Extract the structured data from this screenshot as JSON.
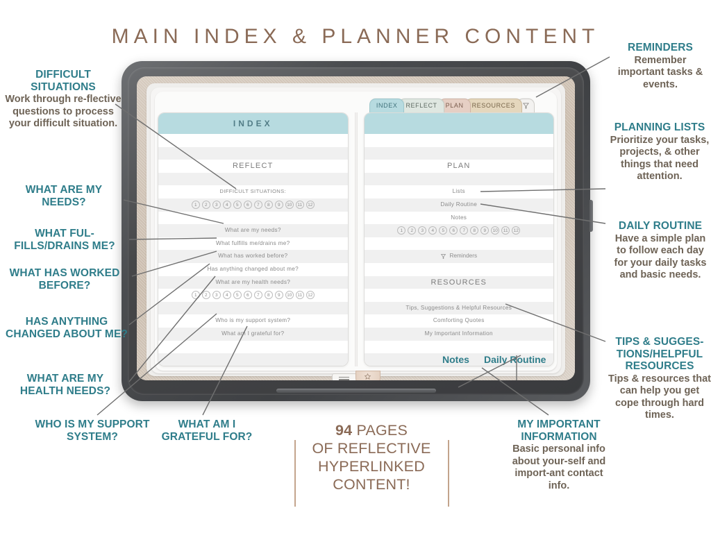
{
  "header": {
    "title": "MAIN INDEX & PLANNER CONTENT"
  },
  "colors": {
    "teal_heading": "#2f7d8a",
    "body_brown": "#6e6356",
    "title_brown": "#8a6a56",
    "page_header_teal": "#b7dbe0",
    "row_alt": "#f0f0f0"
  },
  "tablet": {
    "tabs": [
      {
        "label": "INDEX",
        "name": "tab-index"
      },
      {
        "label": "REFLECT",
        "name": "tab-reflect"
      },
      {
        "label": "PLAN",
        "name": "tab-plan"
      },
      {
        "label": "RESOURCES",
        "name": "tab-resources"
      },
      {
        "label": "",
        "name": "tab-reminders-bell-icon"
      }
    ],
    "left_page": {
      "header": "INDEX",
      "rows": [
        {
          "text": "",
          "type": "blank"
        },
        {
          "text": "",
          "type": "blank"
        },
        {
          "text": "REFLECT",
          "type": "section"
        },
        {
          "text": "",
          "type": "blank"
        },
        {
          "text": "DIFFICULT SITUATIONS:",
          "type": "caption"
        },
        {
          "text": "",
          "type": "numbers"
        },
        {
          "text": "",
          "type": "blank"
        },
        {
          "text": "What are my needs?",
          "type": "link"
        },
        {
          "text": "What fulfills me/drains me?",
          "type": "link"
        },
        {
          "text": "What has worked before?",
          "type": "link"
        },
        {
          "text": "Has anything changed about me?",
          "type": "link"
        },
        {
          "text": "What are my health needs?",
          "type": "link"
        },
        {
          "text": "",
          "type": "numbers"
        },
        {
          "text": "",
          "type": "blank"
        },
        {
          "text": "Who is my support system?",
          "type": "link"
        },
        {
          "text": "What am I grateful for?",
          "type": "link"
        },
        {
          "text": "",
          "type": "blank"
        },
        {
          "text": "",
          "type": "blank"
        },
        {
          "text": "",
          "type": "blank"
        }
      ]
    },
    "right_page": {
      "header": "",
      "rows": [
        {
          "text": "",
          "type": "blank"
        },
        {
          "text": "",
          "type": "blank"
        },
        {
          "text": "PLAN",
          "type": "section"
        },
        {
          "text": "",
          "type": "blank"
        },
        {
          "text": "Lists",
          "type": "link"
        },
        {
          "text": "Daily Routine",
          "type": "link"
        },
        {
          "text": "Notes",
          "type": "link"
        },
        {
          "text": "",
          "type": "numbers"
        },
        {
          "text": "",
          "type": "blank"
        },
        {
          "text": "Reminders",
          "type": "reminder"
        },
        {
          "text": "",
          "type": "blank"
        },
        {
          "text": "RESOURCES",
          "type": "section"
        },
        {
          "text": "",
          "type": "blank"
        },
        {
          "text": "Tips, Suggestions & Helpful Resources",
          "type": "link"
        },
        {
          "text": "Comforting Quotes",
          "type": "link"
        },
        {
          "text": "My Important Information",
          "type": "link"
        },
        {
          "text": "",
          "type": "blank"
        },
        {
          "text": "",
          "type": "blank"
        },
        {
          "text": "",
          "type": "blank"
        }
      ]
    },
    "numbers": [
      "1",
      "2",
      "3",
      "4",
      "5",
      "6",
      "7",
      "8",
      "9",
      "10",
      "11",
      "12"
    ],
    "overlay_labels": [
      {
        "text": "Notes",
        "name": "overlay-label-notes"
      },
      {
        "text": "Daily Routine",
        "name": "overlay-label-daily-routine"
      }
    ]
  },
  "annotations_left": [
    {
      "name": "annotation-difficult-situations",
      "heading": "DIFFICULT SITUATIONS",
      "body": "Work through re-flective questions to process your difficult situation."
    },
    {
      "name": "annotation-what-are-my-needs",
      "heading": "WHAT ARE MY NEEDS?",
      "body": ""
    },
    {
      "name": "annotation-what-fulfills-drains-me",
      "heading": "WHAT FUL-FILLS/DRAINS ME?",
      "body": ""
    },
    {
      "name": "annotation-what-has-worked-before",
      "heading": "WHAT HAS WORKED BEFORE?",
      "body": ""
    },
    {
      "name": "annotation-has-anything-changed",
      "heading": "HAS ANYTHING CHANGED ABOUT ME?",
      "body": ""
    },
    {
      "name": "annotation-what-are-my-health-needs",
      "heading": "WHAT ARE MY HEALTH NEEDS?",
      "body": ""
    },
    {
      "name": "annotation-who-is-my-support-system",
      "heading": "WHO IS MY SUPPORT SYSTEM?",
      "body": ""
    },
    {
      "name": "annotation-what-am-i-grateful-for",
      "heading": "WHAT AM I GRATEFUL FOR?",
      "body": ""
    }
  ],
  "annotations_right": [
    {
      "name": "annotation-reminders",
      "heading": "REMINDERS",
      "body": "Remember important tasks & events."
    },
    {
      "name": "annotation-planning-lists",
      "heading": "PLANNING LISTS",
      "body": "Prioritize your tasks, projects, & other things that need attention."
    },
    {
      "name": "annotation-daily-routine",
      "heading": "DAILY ROUTINE",
      "body": "Have a simple plan to follow each day for your daily tasks and basic needs."
    },
    {
      "name": "annotation-tips-suggestions",
      "heading": "TIPS & SUGGES-TIONS/HELPFUL RESOURCES",
      "body": "Tips & resources that can help you get cope through hard times."
    },
    {
      "name": "annotation-my-important-information",
      "heading": "MY IMPORTANT INFORMATION",
      "body": "Basic personal info about your-self and import-ant contact info."
    }
  ],
  "pages_callout": {
    "count": "94",
    "line1_rest": " PAGES",
    "line2": "OF REFLECTIVE",
    "line3": "HYPERLINKED",
    "line4": "CONTENT!"
  }
}
